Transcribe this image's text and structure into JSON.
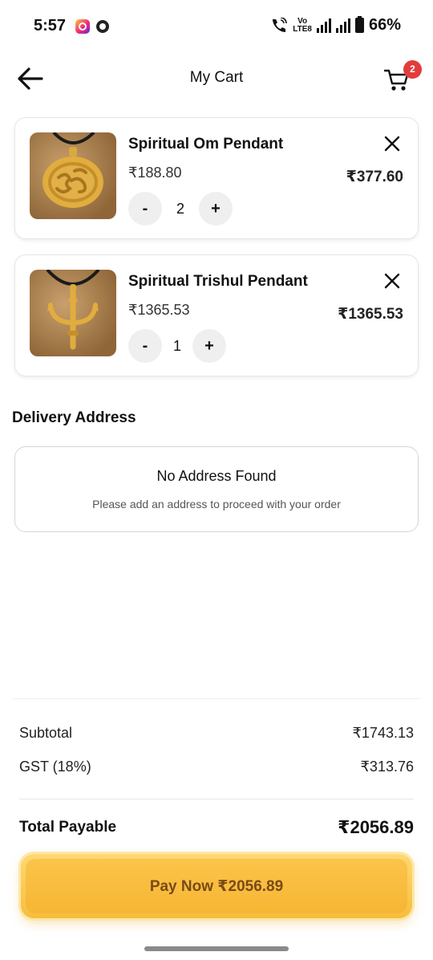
{
  "status_bar": {
    "time": "5:57",
    "network_top": "Vo",
    "network_bottom": "LTE8",
    "battery": "66%",
    "icons": [
      "instagram-icon",
      "chrome-icon",
      "wifi-calling-icon",
      "signal-icon",
      "battery-icon"
    ]
  },
  "header": {
    "title": "My Cart",
    "cart_count": "2"
  },
  "cart": {
    "items": [
      {
        "name": "Spiritual Om Pendant",
        "unit_price": "₹188.80",
        "quantity": "2",
        "total": "₹377.60",
        "minus": "-",
        "plus": "+"
      },
      {
        "name": "Spiritual Trishul Pendant",
        "unit_price": "₹1365.53",
        "quantity": "1",
        "total": "₹1365.53",
        "minus": "-",
        "plus": "+"
      }
    ]
  },
  "delivery": {
    "title": "Delivery Address",
    "empty_title": "No Address Found",
    "empty_hint": "Please add an address to proceed with your order"
  },
  "summary": {
    "subtotal_label": "Subtotal",
    "subtotal_value": "₹1743.13",
    "gst_label": "GST (18%)",
    "gst_value": "₹313.76",
    "total_label": "Total Payable",
    "total_value": "₹2056.89"
  },
  "pay_button": {
    "label": "Pay Now ₹2056.89"
  },
  "colors": {
    "accent": "#f6b634",
    "badge": "#e23c3c",
    "pay_text": "#7a4a16"
  }
}
